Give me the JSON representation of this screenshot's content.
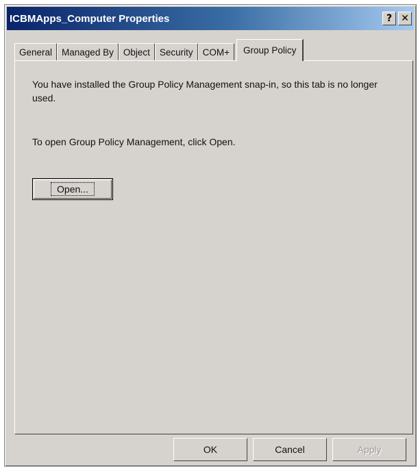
{
  "window": {
    "title": "ICBMApps_Computer Properties",
    "help_glyph": "?",
    "close_glyph": "✕"
  },
  "tabs": [
    {
      "label": "General"
    },
    {
      "label": "Managed By"
    },
    {
      "label": "Object"
    },
    {
      "label": "Security"
    },
    {
      "label": "COM+"
    },
    {
      "label": "Group Policy",
      "active": true
    }
  ],
  "panel": {
    "message": "You have installed the Group Policy Management snap-in, so this tab is no longer used.",
    "instruction": "To open Group Policy Management, click Open.",
    "open_button": "Open..."
  },
  "footer": {
    "ok": "OK",
    "cancel": "Cancel",
    "apply": "Apply"
  },
  "colors": {
    "title_start": "#0a246a",
    "title_end": "#a6caf0",
    "face": "#d6d3ce"
  }
}
